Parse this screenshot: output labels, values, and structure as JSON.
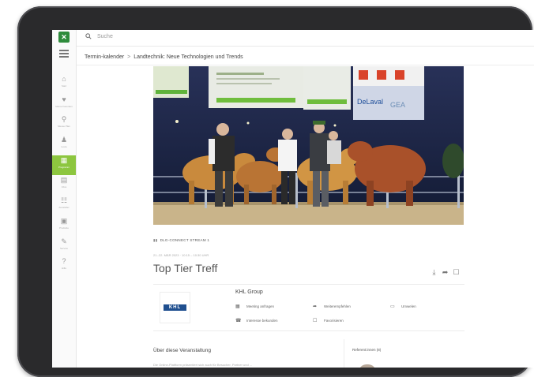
{
  "app": {
    "logo_text": "✕",
    "search_placeholder": "Suche"
  },
  "sidebar": {
    "items": [
      {
        "icon": "⌂",
        "label": "Start"
      },
      {
        "icon": "♥",
        "label": "Meine Favoriten"
      },
      {
        "icon": "⚲",
        "label": "Messe Plan"
      },
      {
        "icon": "♟",
        "label": "Leute"
      },
      {
        "icon": "▦",
        "label": "Programm"
      },
      {
        "icon": "▤",
        "label": "Infos"
      },
      {
        "icon": "☷",
        "label": "Aussteller"
      },
      {
        "icon": "▣",
        "label": "Produkte"
      },
      {
        "icon": "✎",
        "label": "Service"
      },
      {
        "icon": "?",
        "label": "Hilfe"
      }
    ],
    "active_index": 4
  },
  "breadcrumb": {
    "parent": "Termin-kalender",
    "separator": ">",
    "current": "Landtechnik: Neue Technologien und Trends"
  },
  "hero": {
    "screen_texts": [
      "DeLaval",
      "GEA"
    ]
  },
  "event": {
    "category": "DLG-CONNECT STREAM 1",
    "date": "21.-22. MÄR 2023 · 10:15 – 10:30 UHR",
    "title": "Top Tier Treff",
    "actions": [
      {
        "icon": "download-icon",
        "glyph": "⤓"
      },
      {
        "icon": "share-icon",
        "glyph": "➦"
      },
      {
        "icon": "bookmark-icon",
        "glyph": "☐"
      }
    ]
  },
  "organizer": {
    "logo_text": "KHL",
    "name": "KHL Group",
    "actions": [
      {
        "icon": "calendar-icon",
        "glyph": "▦",
        "label": "Meeting anfragen"
      },
      {
        "icon": "share-icon",
        "glyph": "➦",
        "label": "Weiterempfehlen"
      },
      {
        "icon": "card-icon",
        "glyph": "▭",
        "label": "Umwelen"
      },
      {
        "icon": "phone-icon",
        "glyph": "☎",
        "label": "Interesse bekunden"
      },
      {
        "icon": "bookmark-icon",
        "glyph": "☐",
        "label": "Favorisieren"
      }
    ]
  },
  "about": {
    "heading": "Über diese Veranstaltung",
    "text": "Die Online-Plattform präsentiert sich auch für Besucher, Partner und ..."
  },
  "speakers": {
    "heading": "Referent:innen (8)"
  }
}
